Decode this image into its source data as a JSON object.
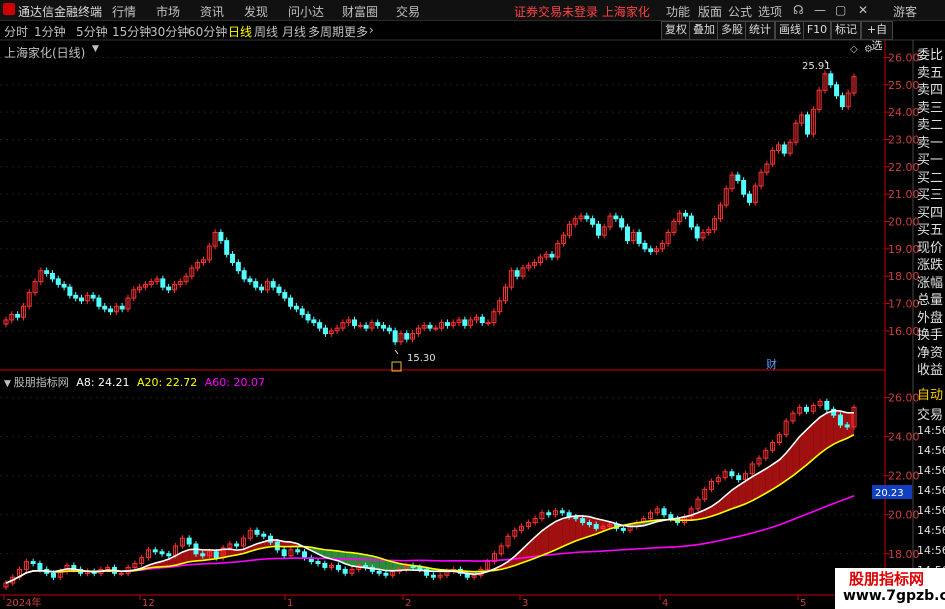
{
  "menubar": {
    "app_name": "通达信金融终端",
    "menus": [
      "行情",
      "市场",
      "资讯",
      "发现",
      "问小达",
      "财富圈",
      "交易"
    ],
    "notice": "证券交易未登录  上海家化",
    "right_menus": [
      "功能",
      "版面",
      "公式",
      "选项"
    ],
    "user": "游客"
  },
  "toolbar": {
    "periods": [
      "分时",
      "1分钟",
      "5分钟",
      "15分钟",
      "30分钟",
      "60分钟",
      "日线",
      "周线",
      "月线",
      "多周期",
      "更多"
    ],
    "active": "日线",
    "buttons": [
      "复权",
      "叠加",
      "多股",
      "统计",
      "画线",
      "F10",
      "标记",
      "+自选"
    ]
  },
  "main_chart": {
    "title": "上海家化(日线)",
    "price_axis": [
      "26.00",
      "25.00",
      "24.00",
      "23.00",
      "22.00",
      "21.00",
      "20.00",
      "19.00",
      "18.00",
      "17.00",
      "16.00"
    ],
    "high_label": "25.91",
    "low_label": "15.30",
    "marker": "财"
  },
  "sub_chart": {
    "name": "股朋指标网",
    "a8": "A8: 24.21",
    "a20": "A20: 22.72",
    "a60": "A60: 20.07",
    "a8_color": "#ffffff",
    "a20_color": "#ffff00",
    "a60_color": "#ff00ff",
    "price_axis": [
      "26.00",
      "24.00",
      "22.00",
      "20.00",
      "18.00"
    ],
    "current_tag": "20.23"
  },
  "date_axis": [
    "2024年",
    "12",
    "1",
    "2",
    "3",
    "4",
    "5"
  ],
  "side_panel": [
    "委比",
    "卖五",
    "卖四",
    "卖三",
    "卖二",
    "卖一",
    "买一",
    "买二",
    "买三",
    "买四",
    "买五",
    "现价",
    "涨跌",
    "涨幅",
    "总量",
    "外盘",
    "换手",
    "净资",
    "收益"
  ],
  "side_panel_bottom": [
    "自动",
    "交易",
    "14:56",
    "14:56",
    "14:56",
    "14:56",
    "14:56",
    "14:56",
    "14:56",
    "14:56"
  ],
  "watermark": {
    "line1": "股朋指标网",
    "line2": "www.7gpzb.com"
  },
  "chart_data": {
    "type": "candlestick",
    "title": "上海家化(日线)",
    "ylim": [
      15.3,
      26.2
    ],
    "up_color": "#ff3232",
    "down_color": "#54ffff",
    "x_ticks": [
      "2024年",
      "12",
      "1",
      "2",
      "3",
      "4",
      "5"
    ],
    "closes": [
      16.4,
      16.6,
      16.5,
      16.9,
      17.4,
      17.8,
      18.2,
      18.1,
      17.9,
      17.7,
      17.6,
      17.3,
      17.2,
      17.1,
      17.3,
      17.2,
      16.9,
      16.8,
      16.7,
      16.9,
      16.8,
      17.2,
      17.5,
      17.6,
      17.7,
      17.8,
      17.9,
      17.6,
      17.5,
      17.7,
      17.8,
      18.0,
      18.3,
      18.5,
      18.6,
      19.1,
      19.6,
      19.3,
      18.8,
      18.5,
      18.2,
      17.9,
      17.8,
      17.6,
      17.5,
      17.8,
      17.6,
      17.4,
      17.2,
      16.9,
      16.8,
      16.6,
      16.4,
      16.3,
      16.1,
      15.9,
      16.0,
      16.1,
      16.3,
      16.4,
      16.2,
      16.2,
      16.1,
      16.3,
      16.2,
      16.1,
      16.0,
      15.6,
      15.9,
      15.7,
      15.9,
      16.1,
      16.2,
      16.1,
      16.1,
      16.3,
      16.2,
      16.3,
      16.4,
      16.2,
      16.4,
      16.5,
      16.3,
      16.3,
      16.7,
      17.1,
      17.6,
      18.2,
      18.0,
      18.3,
      18.4,
      18.5,
      18.7,
      18.8,
      18.7,
      19.2,
      19.5,
      19.9,
      20.1,
      20.2,
      20.1,
      19.9,
      19.5,
      19.8,
      20.2,
      20.1,
      19.8,
      19.3,
      19.6,
      19.2,
      19.0,
      18.9,
      19.0,
      19.2,
      19.6,
      20.0,
      20.3,
      20.2,
      19.8,
      19.4,
      19.6,
      19.7,
      20.1,
      20.6,
      21.2,
      21.7,
      21.5,
      21.0,
      20.7,
      21.3,
      21.8,
      22.1,
      22.6,
      22.8,
      22.5,
      22.9,
      23.6,
      23.9,
      23.2,
      24.1,
      24.8,
      25.4,
      25.0,
      24.6,
      24.2,
      24.7,
      25.3
    ]
  },
  "indicator_data": {
    "ylim": [
      16.4,
      26.8
    ],
    "closes": [
      16.5,
      16.8,
      17.2,
      17.6,
      17.5,
      17.2,
      17.0,
      16.8,
      17.1,
      17.4,
      17.2,
      17.0,
      17.1,
      17.0,
      17.2,
      17.3,
      17.0,
      17.0,
      17.3,
      17.5,
      17.8,
      18.2,
      18.1,
      18.0,
      17.9,
      18.4,
      18.8,
      18.5,
      18.0,
      17.9,
      18.1,
      17.8,
      18.3,
      18.5,
      18.4,
      18.8,
      19.2,
      19.0,
      18.9,
      18.6,
      18.2,
      17.9,
      18.2,
      18.1,
      17.8,
      17.6,
      17.5,
      17.3,
      17.4,
      17.2,
      17.0,
      17.2,
      17.4,
      17.3,
      17.1,
      17.0,
      16.9,
      17.1,
      17.2,
      17.4,
      17.3,
      17.2,
      16.9,
      16.8,
      16.9,
      17.1,
      17.2,
      17.0,
      16.8,
      16.9,
      17.2,
      17.6,
      18.0,
      18.4,
      18.9,
      19.2,
      19.4,
      19.6,
      19.8,
      20.1,
      20.0,
      20.2,
      20.1,
      19.9,
      19.8,
      19.6,
      19.5,
      19.3,
      19.4,
      19.5,
      19.3,
      19.2,
      19.4,
      19.6,
      19.8,
      20.1,
      20.3,
      20.0,
      19.8,
      19.6,
      19.9,
      20.3,
      20.8,
      21.3,
      21.7,
      21.9,
      22.2,
      22.0,
      21.8,
      22.1,
      22.6,
      22.9,
      23.3,
      23.7,
      24.1,
      24.8,
      25.2,
      25.5,
      25.3,
      25.6,
      25.8,
      25.4,
      25.1,
      24.6,
      24.5,
      25.5
    ]
  }
}
